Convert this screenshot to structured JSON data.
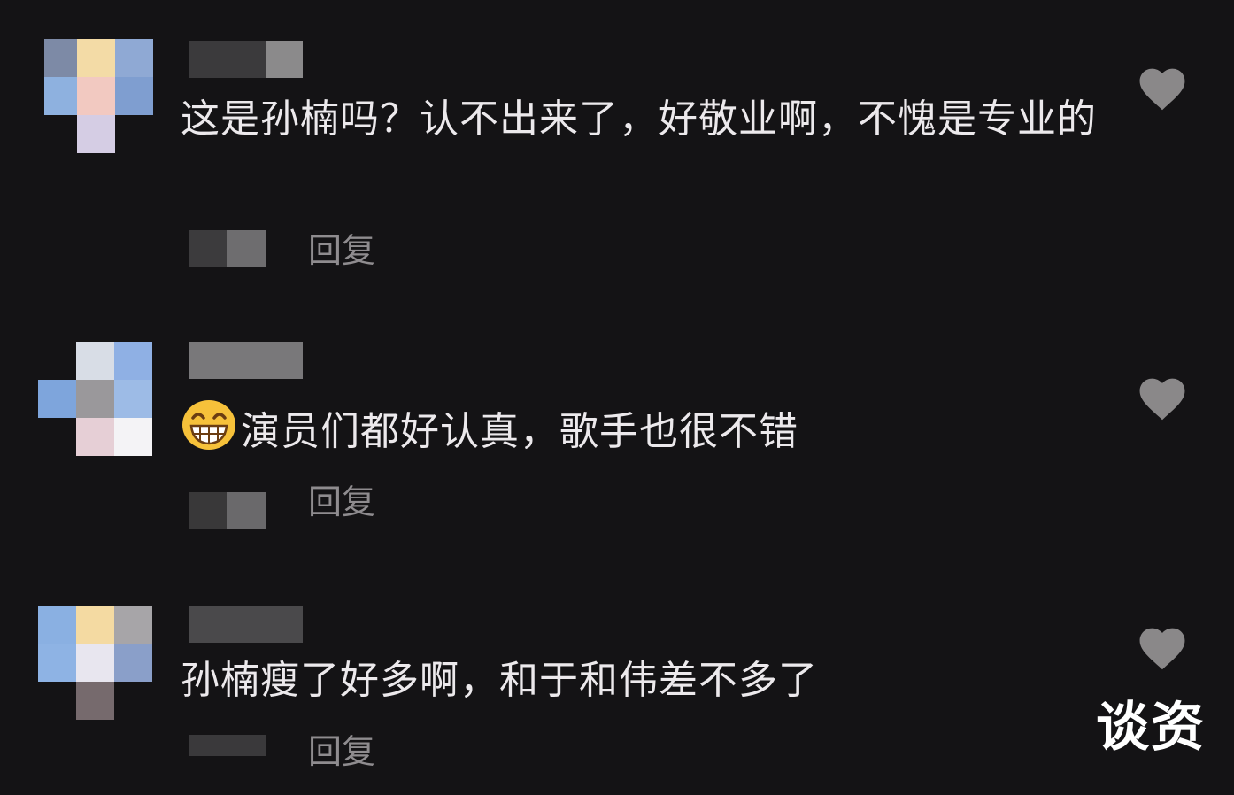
{
  "comments": [
    {
      "text": "这是孙楠吗？认不出来了，好敬业啊，不愧是专业的",
      "reply_label": "回复"
    },
    {
      "emoji": "grinning-face-emoji",
      "text": "演员们都好认真，歌手也很不错",
      "reply_label": "回复"
    },
    {
      "text": "孙楠瘦了好多啊，和于和伟差不多了",
      "reply_label": "回复"
    }
  ],
  "watermark": "谈资",
  "colors": {
    "background": "#141315",
    "comment_text": "#ece9ec",
    "reply_text": "#8f8c8f",
    "like_icon": "#8a8889"
  }
}
